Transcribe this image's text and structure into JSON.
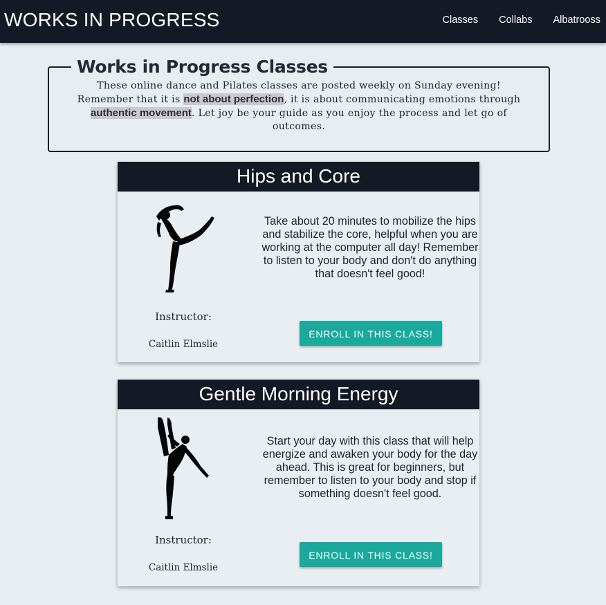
{
  "nav": {
    "brand": "WORKS IN PROGRESS",
    "links": [
      "Classes",
      "Collabs",
      "Albatrooss"
    ]
  },
  "intro": {
    "title": "Works in Progress Classes",
    "text_1": "These online dance and Pilates classes are posted weekly on Sunday evening! Remember that it is ",
    "highlight_1": "not about perfection",
    "text_2": ", it is about communicating emotions through ",
    "highlight_2": "authentic movement",
    "text_3": ". Let joy be your guide as you enjoy the process and let go of outcomes."
  },
  "classes": [
    {
      "title": "Hips and Core",
      "instructor_label": "Instructor:",
      "instructor_name": "Caitlin Elmslie",
      "description": "Take about 20 minutes to mobilize the hips and stabilize the core, helpful when you are working at the computer all day! Remember to listen to your body and don't do anything that doesn't feel good!",
      "button_label": "ENROLL IN THIS CLASS!",
      "image_icon": "dancer-arabesque-silhouette-icon"
    },
    {
      "title": "Gentle Morning Energy",
      "instructor_label": "Instructor:",
      "instructor_name": "Caitlin Elmslie",
      "description": "Start your day with this class that will help energize and awaken your body for the day ahead. This is great for beginners, but remember to listen to your body and stop if something doesn't feel good.",
      "button_label": "ENROLL IN THIS CLASS!",
      "image_icon": "dancer-leg-extension-silhouette-icon"
    }
  ],
  "colors": {
    "navbar": "#131a25",
    "background": "#e7eef2",
    "button": "#1aa99c",
    "highlight": "#c8c9cc"
  }
}
